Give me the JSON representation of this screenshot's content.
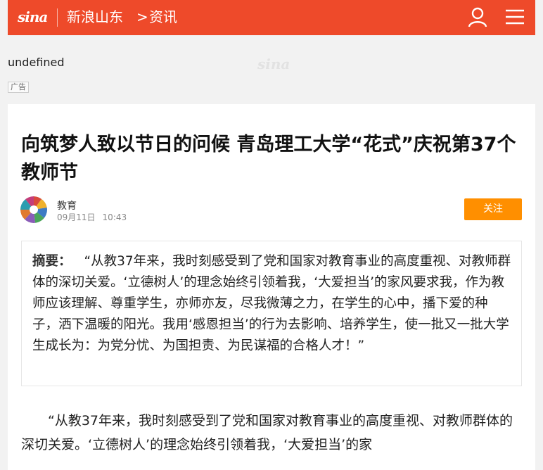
{
  "header": {
    "logo_text": "sina",
    "site_name": "新浪山东",
    "breadcrumb_separator": ">",
    "section": "资讯",
    "user_icon": "user-icon",
    "menu_icon": "hamburger-menu-icon",
    "brand_color": "#ee4a2a"
  },
  "banner": {
    "image_alt": "undefined",
    "watermark": "sina",
    "ad_label": "广告"
  },
  "article": {
    "title": "向筑梦人致以节日的问候 青岛理工大学“花式”庆祝第37个教师节",
    "author": "教育",
    "date": "09月11日",
    "time": "10:43",
    "follow_label": "关注",
    "follow_color": "#ff8f00",
    "summary_label": "摘要：",
    "summary_text": "“从教37年来，我时刻感受到了党和国家对教育事业的高度重视、对教师群体的深切关爱。‘立德树人’的理念始终引领着我，‘大爱担当’的家风要求我，作为教师应该理解、尊重学生，亦师亦友，尽我微薄之力，在学生的心中，播下爱的种子，洒下温暖的阳光。我用‘感恩担当’的行为去影响、培养学生，使一批又一批大学生成长为：为党分忧、为国担责、为民谋福的合格人才！”",
    "body_paragraph": "“从教37年来，我时刻感受到了党和国家对教育事业的高度重视、对教师群体的深切关爱。‘立德树人’的理念始终引领着我，‘大爱担当’的家"
  }
}
